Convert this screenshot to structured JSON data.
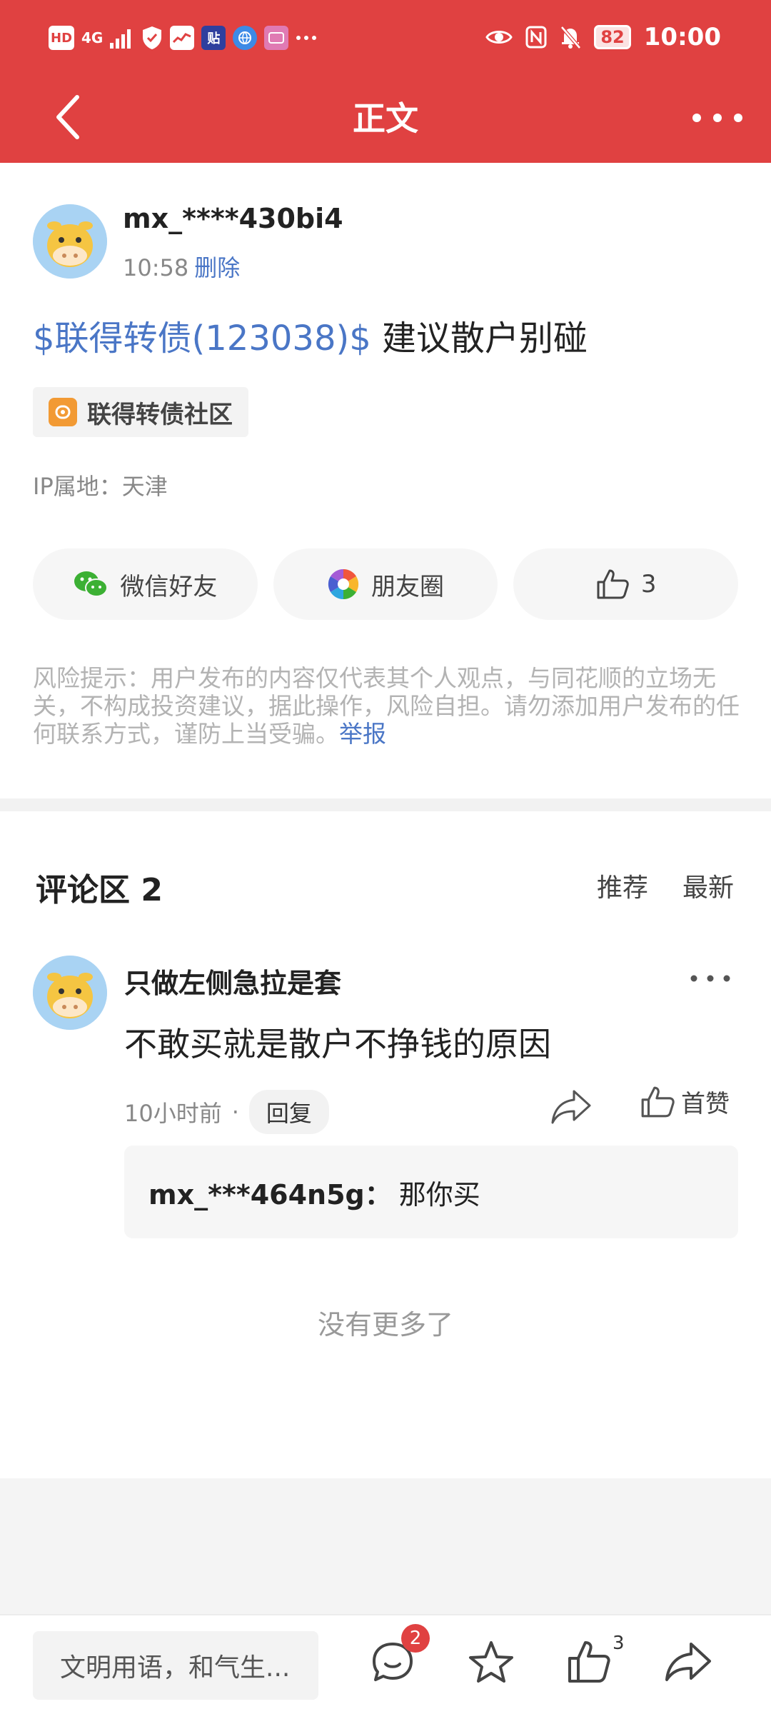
{
  "status_bar": {
    "left_labels": [
      "HD",
      "4G",
      "贴"
    ],
    "battery": "82",
    "time": "10:00"
  },
  "nav": {
    "title": "正文"
  },
  "post": {
    "username": "mx_****430bi4",
    "time": "10:58",
    "delete_label": "删除",
    "stock_tag": "$联得转债(123038)$",
    "text": " 建议散户别碰",
    "community": "联得转债社区",
    "ip": "IP属地：天津",
    "share_wechat": "微信好友",
    "share_moments": "朋友圈",
    "like_count": "3",
    "risk_text": "风险提示：用户发布的内容仅代表其个人观点，与同花顺的立场无关，不构成投资建议，据此操作，风险自担。请勿添加用户发布的任何联系方式，谨防上当受骗。",
    "report_label": "举报"
  },
  "comments": {
    "title": "评论区 2",
    "sort_recommend": "推荐",
    "sort_latest": "最新",
    "items": [
      {
        "user": "只做左侧急拉是套",
        "text": "不敢买就是散户不挣钱的原因",
        "time": "10小时前",
        "dot": "·",
        "reply_label": "回复",
        "like_label": "首赞",
        "sub_reply": {
          "user": "mx_***464n5g：",
          "text": "那你买"
        }
      }
    ],
    "no_more": "没有更多了"
  },
  "bottom_bar": {
    "input_placeholder": "文明用语，和气生...",
    "comment_badge": "2",
    "like_count": "3"
  },
  "colors": {
    "brand_red": "#e04141",
    "link_blue": "#4a76c6"
  }
}
